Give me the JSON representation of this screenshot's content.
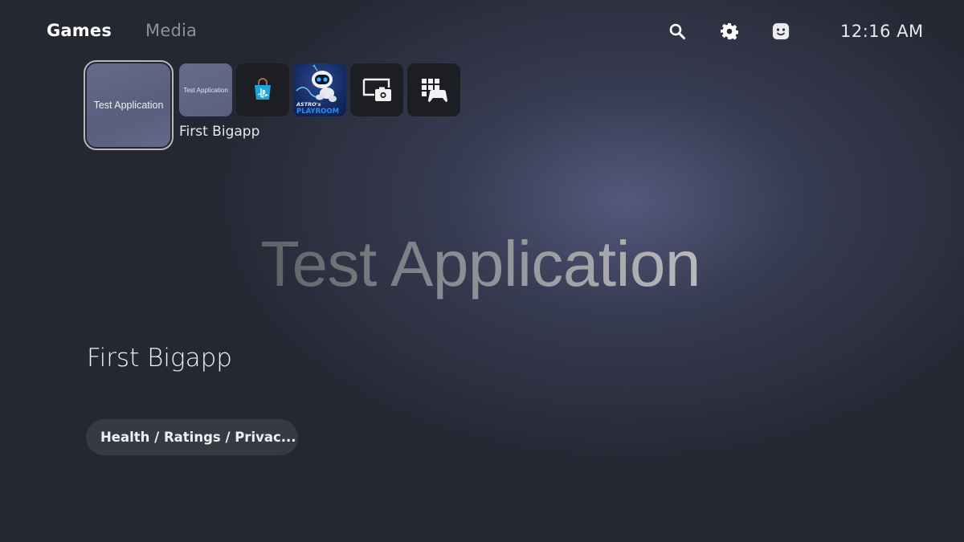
{
  "nav": {
    "tabs": [
      {
        "label": "Games",
        "active": true
      },
      {
        "label": "Media",
        "active": false
      }
    ]
  },
  "header": {
    "icons": [
      "search-icon",
      "gear-icon",
      "profile-avatar-icon"
    ],
    "clock": "12:16 AM"
  },
  "tiles": {
    "selected": {
      "label": "Test Application"
    },
    "items": [
      {
        "name": "test-application",
        "label": "Test Application"
      },
      {
        "name": "playstation-store",
        "icon": "store-bag-icon"
      },
      {
        "name": "astros-playroom",
        "art_text_top": "ASTRO's",
        "art_text_bottom": "PLAYROOM"
      },
      {
        "name": "media-gallery",
        "icon": "capture-gallery-icon"
      },
      {
        "name": "game-library",
        "icon": "game-library-icon"
      }
    ],
    "selected_caption": "First Bigapp"
  },
  "hero": {
    "title": "Test Application"
  },
  "game": {
    "title": "First Bigapp",
    "info_button_label": "Health / Ratings / Privac..."
  },
  "colors": {
    "background": "#23252f",
    "glow": "#5c628a",
    "store_blue": "#1fa3d9",
    "astro_blue": "#2b7bd8"
  }
}
